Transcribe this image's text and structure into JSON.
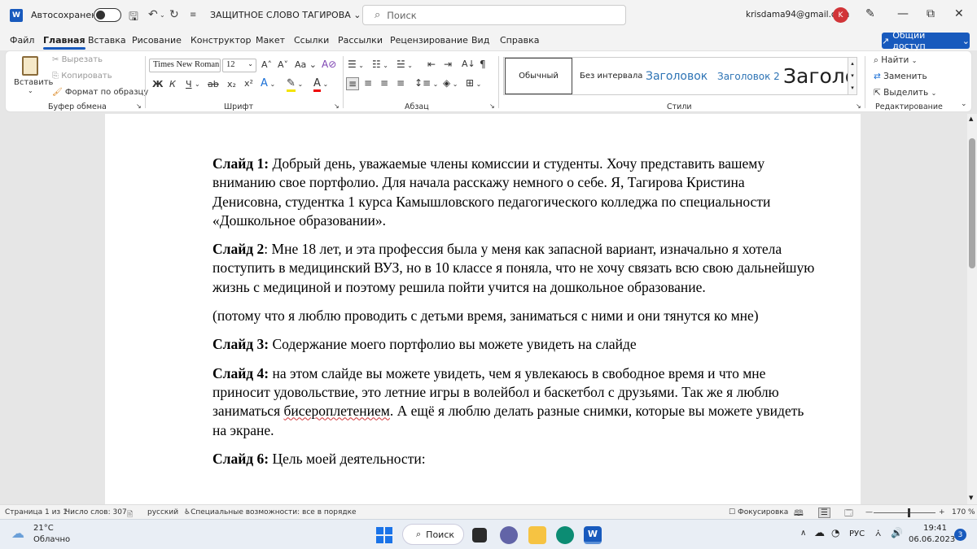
{
  "titlebar": {
    "logo": "W",
    "autosave_label": "Автосохранение",
    "doc_title": "ЗАЩИТНОЕ СЛОВО ТАГИРОВА",
    "search_placeholder": "Поиск",
    "email": "krisdama94@gmail.com",
    "avatar_letter": "K"
  },
  "menu": {
    "tabs": [
      "Файл",
      "Главная",
      "Вставка",
      "Рисование",
      "Конструктор",
      "Макет",
      "Ссылки",
      "Рассылки",
      "Рецензирование",
      "Вид",
      "Справка"
    ],
    "share_label": "Общий доступ"
  },
  "ribbon": {
    "clipboard": {
      "paste": "Вставить",
      "cut": "Вырезать",
      "copy": "Копировать",
      "format_painter": "Формат по образцу",
      "group_label": "Буфер обмена"
    },
    "font": {
      "font_name": "Times New Roman",
      "font_size": "12",
      "bold": "Ж",
      "italic": "К",
      "underline": "Ч",
      "group_label": "Шрифт"
    },
    "paragraph": {
      "group_label": "Абзац"
    },
    "styles": {
      "items": [
        "Обычный",
        "Без интервала",
        "Заголовок",
        "Заголовок 2",
        "Заголо"
      ],
      "group_label": "Стили"
    },
    "editing": {
      "find": "Найти",
      "replace": "Заменить",
      "select": "Выделить",
      "group_label": "Редактирование"
    }
  },
  "document": {
    "paragraphs": [
      {
        "label": "Слайд 1:",
        "text": " Добрый день, уважаемые члены комиссии и студенты. Хочу представить вашему вниманию свое портфолио. Для начала расскажу немного о себе. Я, Тагирова Кристина Денисовна, студентка 1 курса Камышловского педагогического колледжа по специальности «Дошкольное образовании»."
      },
      {
        "label": "Слайд 2",
        "text": ": Мне 18 лет, и эта профессия была у меня как запасной вариант, изначально я хотела поступить в медицинский ВУЗ, но в 10 классе я поняла, что не хочу связать всю свою дальнейшую жизнь с медициной и поэтому решила пойти учится на дошкольное образование."
      },
      {
        "label": "",
        "text": "(потому что я люблю проводить с детьми время, заниматься с ними и они тянутся ко мне)"
      },
      {
        "label": "Слайд 3:",
        "text": " Содержание моего портфолио вы можете увидеть на слайде"
      },
      {
        "label": "Слайд 4:",
        "text_before": " на этом слайде вы можете увидеть, чем я увлекаюсь в свободное время и что мне приносит удовольствие, это летние игры в волейбол и баскетбол с друзьями. Так же я люблю заниматься ",
        "misspelled": "бисероплетением",
        "text_after": ". А ещё я люблю делать разные снимки, которые вы можете увидеть на экране."
      },
      {
        "label": "Слайд 6:",
        "text": " Цель моей деятельности:"
      }
    ]
  },
  "statusbar": {
    "page": "Страница 1 из 1",
    "words": "Число слов: 307",
    "language": "русский",
    "accessibility": "Специальные возможности: все в порядке",
    "focus": "Фокусировка",
    "zoom": "170 %"
  },
  "taskbar": {
    "temperature": "21°C",
    "weather": "Облачно",
    "search": "Поиск",
    "lang": "РУС",
    "time": "19:41",
    "date": "06.06.2023",
    "notifications": "3"
  },
  "colors": {
    "accent": "#185abd",
    "avatar": "#d13438"
  }
}
